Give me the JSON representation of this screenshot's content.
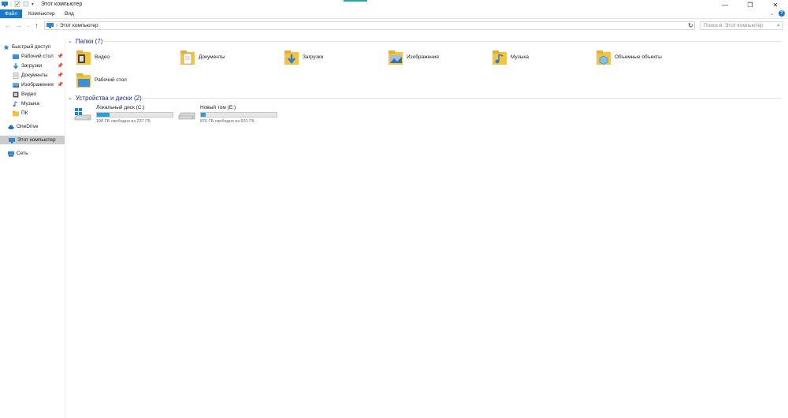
{
  "window": {
    "title": "Этот компьютер",
    "controls": [
      "minimize",
      "maximize",
      "close"
    ]
  },
  "ribbon": {
    "tabs": [
      "Файл",
      "Компьютер",
      "Вид"
    ]
  },
  "address_bar": {
    "path": "Этот компьютер",
    "search_placeholder": "Поиск в: Этот компьютер"
  },
  "sidebar": {
    "items": [
      {
        "label": "Быстрый доступ",
        "icon": "star-icon",
        "pinned": false
      },
      {
        "label": "Рабочий стол",
        "icon": "desktop-folder-icon",
        "pinned": true
      },
      {
        "label": "Загрузки",
        "icon": "download-icon",
        "pinned": true
      },
      {
        "label": "Документы",
        "icon": "documents-icon",
        "pinned": true
      },
      {
        "label": "Изображения",
        "icon": "pictures-icon",
        "pinned": true
      },
      {
        "label": "Видео",
        "icon": "video-icon",
        "pinned": false
      },
      {
        "label": "Музыка",
        "icon": "music-icon",
        "pinned": false
      },
      {
        "label": "ПК",
        "icon": "folder-icon",
        "pinned": false
      },
      {
        "label": "OneDrive",
        "icon": "cloud-icon",
        "pinned": false
      },
      {
        "label": "Этот компьютер",
        "icon": "computer-icon",
        "pinned": false,
        "selected": true
      },
      {
        "label": "Сеть",
        "icon": "network-icon",
        "pinned": false
      }
    ]
  },
  "folders_group": {
    "title": "Папки (7)",
    "items": [
      {
        "label": "Видео",
        "icon": "video-folder-icon"
      },
      {
        "label": "Документы",
        "icon": "documents-folder-icon"
      },
      {
        "label": "Загрузки",
        "icon": "downloads-folder-icon"
      },
      {
        "label": "Изображения",
        "icon": "pictures-folder-icon"
      },
      {
        "label": "Музыка",
        "icon": "music-folder-icon"
      },
      {
        "label": "Объемные объекты",
        "icon": "3d-objects-folder-icon"
      },
      {
        "label": "Рабочий стол",
        "icon": "desktop-folder-icon"
      }
    ]
  },
  "drives_group": {
    "title": "Устройства и диски (2)",
    "items": [
      {
        "label": "Локальный диск (C:)",
        "free_text": "198 ГБ свободно из 237 ГБ",
        "used_fraction": 0.165
      },
      {
        "label": "Новый том (E:)",
        "free_text": "876 ГБ свободно из 931 ГБ",
        "used_fraction": 0.06
      }
    ]
  },
  "colors": {
    "accent": "#1979ca",
    "bar_fill": "#26a0da",
    "group_header": "#1e3287",
    "folder_yellow": "#f5c342"
  }
}
